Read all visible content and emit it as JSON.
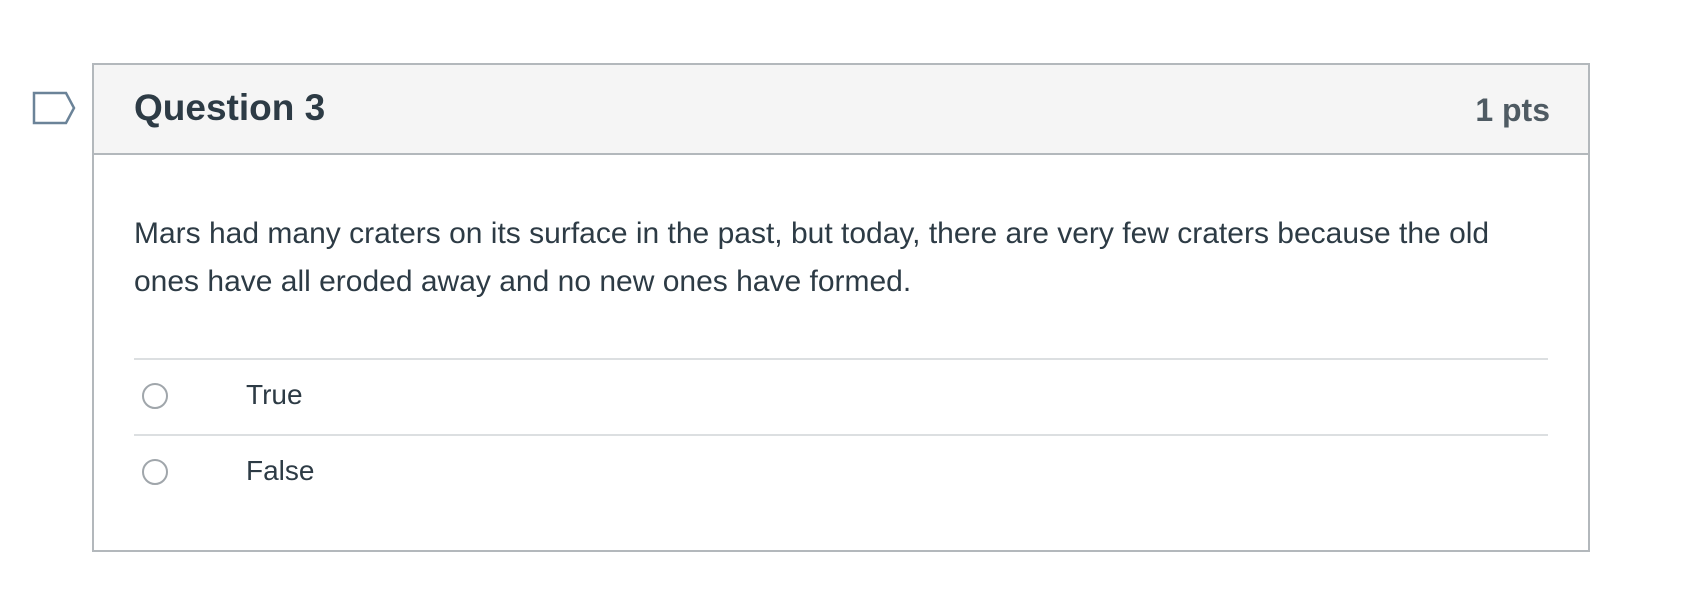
{
  "question": {
    "title": "Question 3",
    "points": "1 pts",
    "text": "Mars had many craters on its surface in the past, but today, there are very few craters because the old ones have all eroded away and no new ones have formed.",
    "answers": [
      {
        "label": "True"
      },
      {
        "label": "False"
      }
    ],
    "flag_icon": "flag-question-icon"
  },
  "colors": {
    "text": "#2d3b45",
    "header_bg": "#f5f5f5",
    "border": "#b3b8bc",
    "divider": "#dcdfe1",
    "flag": "#6b8398"
  }
}
